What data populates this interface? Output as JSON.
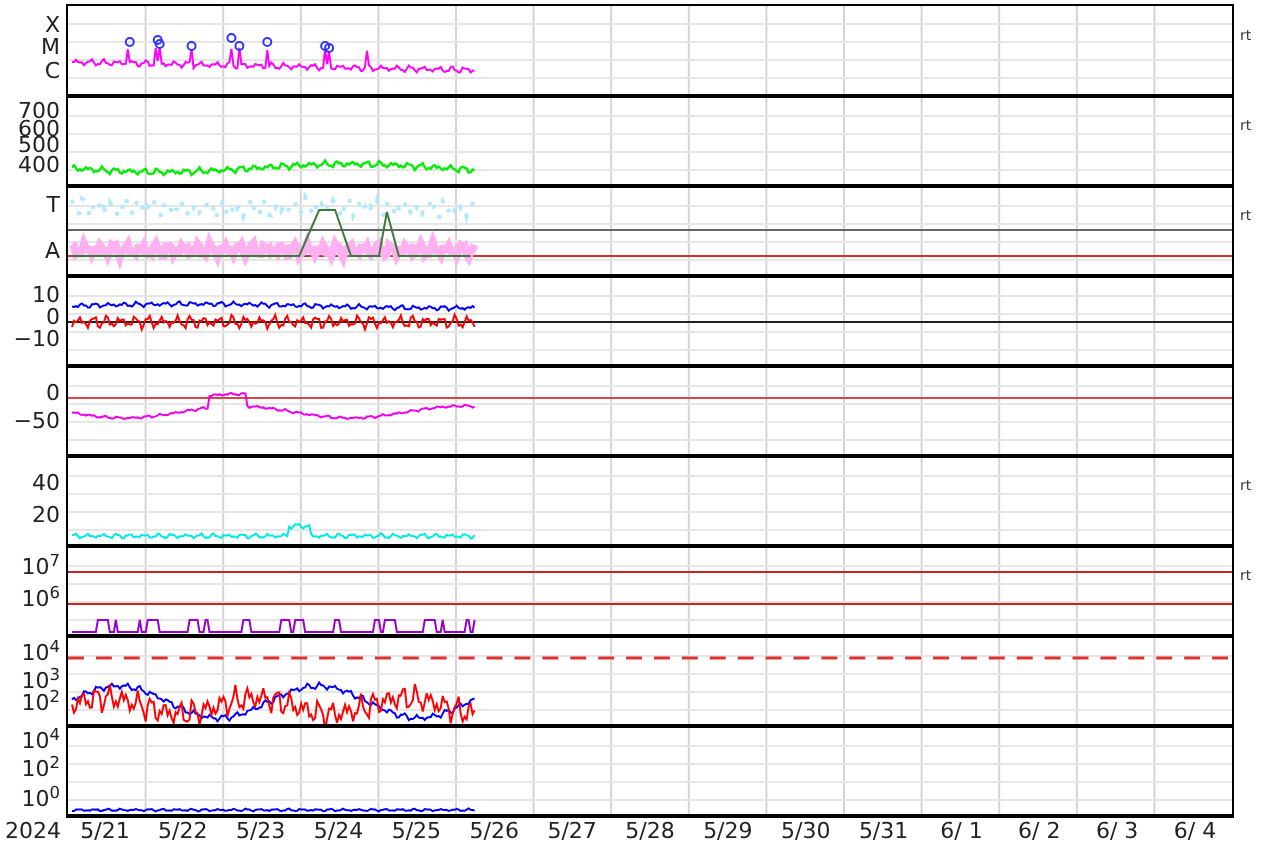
{
  "panels": [
    {
      "ticks": [
        "X",
        "M",
        "C"
      ],
      "right_label": "rt"
    },
    {
      "ticks": [
        "700",
        "600",
        "500",
        "400"
      ],
      "right_label": "rt"
    },
    {
      "ticks": [
        "T",
        "A"
      ],
      "right_label": "rt"
    },
    {
      "ticks": [
        "10",
        "0",
        "−10"
      ]
    },
    {
      "ticks": [
        "0",
        "−50"
      ]
    },
    {
      "ticks": [
        "40",
        "20"
      ],
      "right_label": "rt"
    },
    {
      "ticks": [
        "10$^{7}$",
        "10$^{6}$"
      ],
      "right_label": "rt"
    },
    {
      "ticks": [
        "10$^{4}$",
        "10$^{3}$",
        "10$^{2}$"
      ]
    },
    {
      "ticks": [
        "10$^{4}$",
        "10$^{2}$",
        "10$^{0}$"
      ]
    }
  ],
  "x_axis": {
    "year": "2024",
    "days": [
      "5/21",
      "5/22",
      "5/23",
      "5/24",
      "5/25",
      "5/26",
      "5/27",
      "5/28",
      "5/29",
      "5/30",
      "5/31",
      "6/ 1",
      "6/ 2",
      "6/ 3",
      "6/ 4"
    ]
  }
}
